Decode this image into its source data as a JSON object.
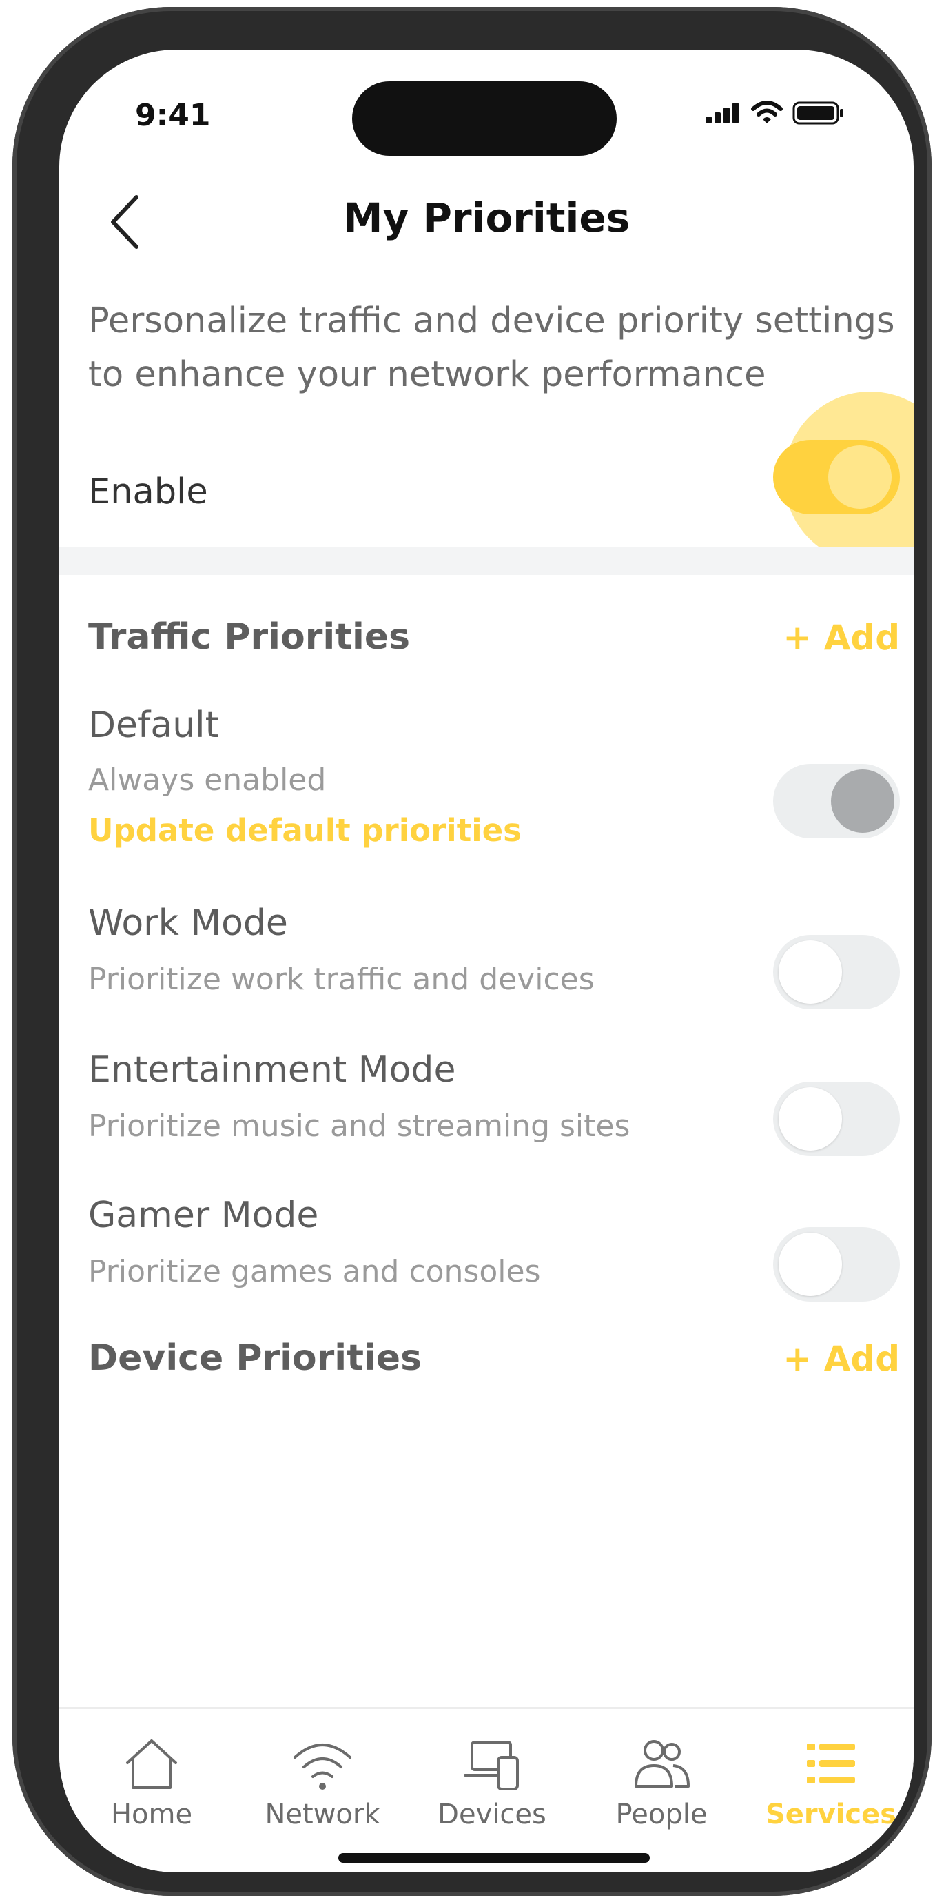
{
  "status_bar": {
    "time": "9:41"
  },
  "header": {
    "title": "My Priorities"
  },
  "intro": {
    "text": "Personalize traffic and device priority settings to enhance your network performance"
  },
  "enable": {
    "label": "Enable",
    "on": true
  },
  "traffic_priorities": {
    "title": "Traffic Priorities",
    "add_label": "+ Add",
    "items": [
      {
        "title": "Default",
        "subtitle": "Always enabled",
        "link": "Update default priorities",
        "state": "locked-on"
      },
      {
        "title": "Work Mode",
        "subtitle": "Prioritize work traffic and devices",
        "state": "off"
      },
      {
        "title": "Entertainment Mode",
        "subtitle": "Prioritize music and streaming sites",
        "state": "off"
      },
      {
        "title": "Gamer Mode",
        "subtitle": "Prioritize games and consoles",
        "state": "off"
      }
    ]
  },
  "device_priorities": {
    "title": "Device Priorities",
    "add_label": "+ Add"
  },
  "tabbar": {
    "tabs": [
      {
        "label": "Home",
        "icon": "home-icon"
      },
      {
        "label": "Network",
        "icon": "wifi-icon"
      },
      {
        "label": "Devices",
        "icon": "devices-icon"
      },
      {
        "label": "People",
        "icon": "people-icon"
      },
      {
        "label": "Services",
        "icon": "list-icon",
        "active": true
      }
    ]
  },
  "colors": {
    "accent": "#FFD23F",
    "text_primary": "#111111",
    "text_secondary": "#6B6B6B",
    "toggle_track": "#ECEEEF"
  }
}
